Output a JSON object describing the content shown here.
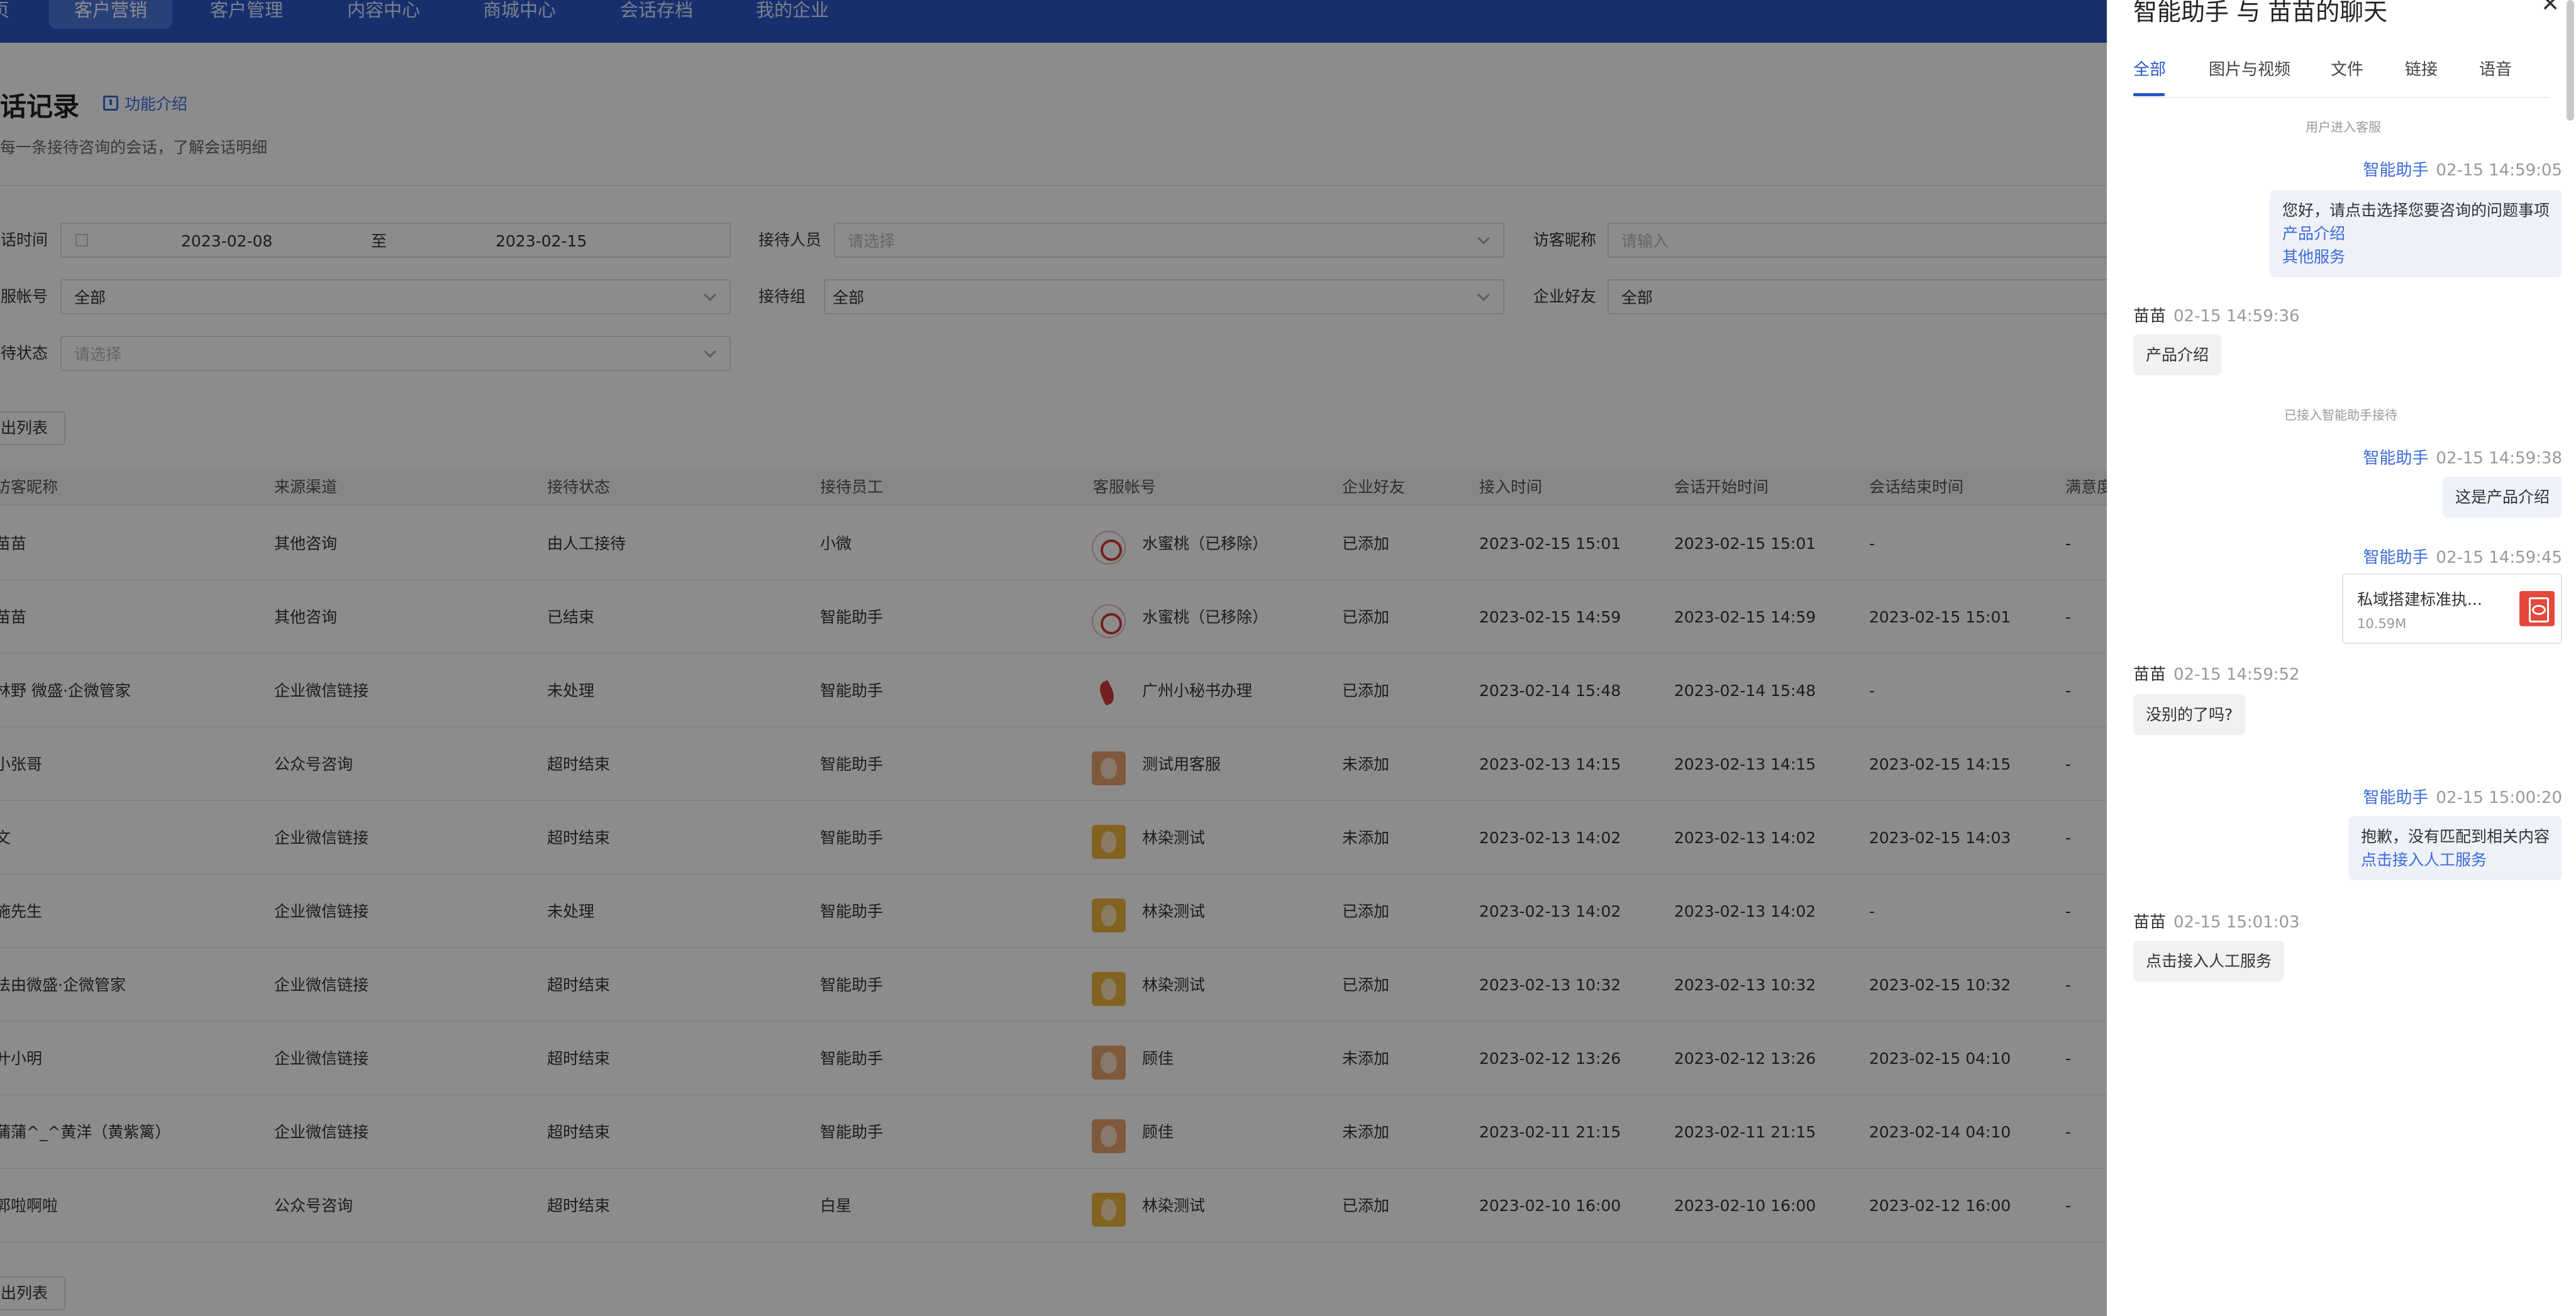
{
  "nav": {
    "items": [
      {
        "label": "页"
      },
      {
        "label": "客户营销"
      },
      {
        "label": "客户管理"
      },
      {
        "label": "内容中心"
      },
      {
        "label": "商城中心"
      },
      {
        "label": "会话存档"
      },
      {
        "label": "我的企业"
      }
    ],
    "active_index": 1
  },
  "page": {
    "title": "会话记录",
    "feature_link": "功能介绍",
    "subtitle": "查看每一条接待咨询的会话，了解会话明细"
  },
  "filters": {
    "session_time_label": "会话时间",
    "date_start": "2023-02-08",
    "date_sep": "至",
    "date_end": "2023-02-15",
    "staff_label": "接待人员",
    "staff_placeholder": "请选择",
    "visitor_nickname_label": "访客昵称",
    "visitor_nickname_placeholder": "请输入",
    "service_account_label": "客服帐号",
    "service_account_value": "全部",
    "group_label": "接待组",
    "group_value": "全部",
    "wecom_friend_label": "企业好友",
    "wecom_friend_value": "全部",
    "status_label": "接待状态",
    "status_placeholder": "请选择"
  },
  "export_label": "导出列表",
  "table": {
    "headers": [
      "访客昵称",
      "来源渠道",
      "接待状态",
      "接待员工",
      "客服帐号",
      "企业好友",
      "接入时间",
      "会话开始时间",
      "会话结束时间",
      "满意度"
    ],
    "rows": [
      {
        "nickname": "苗苗",
        "channel": "其他咨询",
        "status": "由人工接待",
        "staff": "小微",
        "avatar": "logo-icon",
        "account": "水蜜桃（已移除）",
        "friend": "已添加",
        "join": "2023-02-15 15:01",
        "start": "2023-02-15 15:01",
        "end": "-",
        "sat": "-"
      },
      {
        "nickname": "苗苗",
        "channel": "其他咨询",
        "status": "已结束",
        "staff": "智能助手",
        "avatar": "logo-icon",
        "account": "水蜜桃（已移除）",
        "friend": "已添加",
        "join": "2023-02-15 14:59",
        "start": "2023-02-15 14:59",
        "end": "2023-02-15 15:01",
        "sat": "-"
      },
      {
        "nickname": "林野 微盛·企微管家",
        "channel": "企业微信链接",
        "status": "未处理",
        "staff": "智能助手",
        "avatar": "bird-icon",
        "account": "广州小秘书办理",
        "friend": "已添加",
        "join": "2023-02-14 15:48",
        "start": "2023-02-14 15:48",
        "end": "-",
        "sat": "-"
      },
      {
        "nickname": "小张哥",
        "channel": "公众号咨询",
        "status": "超时结束",
        "staff": "智能助手",
        "avatar": "girl-avatar-icon",
        "account": "测试用客服",
        "friend": "未添加",
        "join": "2023-02-13 14:15",
        "start": "2023-02-13 14:15",
        "end": "2023-02-15 14:15",
        "sat": "-"
      },
      {
        "nickname": "文",
        "channel": "企业微信链接",
        "status": "超时结束",
        "staff": "智能助手",
        "avatar": "yellow-avatar-icon",
        "account": "林染测试",
        "friend": "未添加",
        "join": "2023-02-13 14:02",
        "start": "2023-02-13 14:02",
        "end": "2023-02-15 14:03",
        "sat": "-"
      },
      {
        "nickname": "施先生",
        "channel": "企业微信链接",
        "status": "未处理",
        "staff": "智能助手",
        "avatar": "yellow-avatar-icon",
        "account": "林染测试",
        "friend": "已添加",
        "join": "2023-02-13 14:02",
        "start": "2023-02-13 14:02",
        "end": "-",
        "sat": "-"
      },
      {
        "nickname": "法由微盛·企微管家",
        "channel": "企业微信链接",
        "status": "超时结束",
        "staff": "智能助手",
        "avatar": "yellow-avatar-icon",
        "account": "林染测试",
        "friend": "已添加",
        "join": "2023-02-13 10:32",
        "start": "2023-02-13 10:32",
        "end": "2023-02-15 10:32",
        "sat": "-"
      },
      {
        "nickname": "叶小明",
        "channel": "企业微信链接",
        "status": "超时结束",
        "staff": "智能助手",
        "avatar": "girl-avatar-icon",
        "account": "顾佳",
        "friend": "未添加",
        "join": "2023-02-12 13:26",
        "start": "2023-02-12 13:26",
        "end": "2023-02-15 04:10",
        "sat": "-"
      },
      {
        "nickname": "蒲蒲^_^黄洋（黄紫篱）",
        "channel": "企业微信链接",
        "status": "超时结束",
        "staff": "智能助手",
        "avatar": "girl-avatar-icon",
        "account": "顾佳",
        "friend": "未添加",
        "join": "2023-02-11 21:15",
        "start": "2023-02-11 21:15",
        "end": "2023-02-14 04:10",
        "sat": "-"
      },
      {
        "nickname": "郭啦啊啦",
        "channel": "公众号咨询",
        "status": "超时结束",
        "staff": "白星",
        "avatar": "yellow-avatar-icon",
        "account": "林染测试",
        "friend": "已添加",
        "join": "2023-02-10 16:00",
        "start": "2023-02-10 16:00",
        "end": "2023-02-12 16:00",
        "sat": "-"
      }
    ]
  },
  "drawer": {
    "title": "智能助手 与 苗苗的聊天",
    "close": "✕",
    "tabs": [
      "全部",
      "图片与视频",
      "文件",
      "链接",
      "语音"
    ],
    "messages": {
      "sys1": "用户进入客服",
      "m1_name": "智能助手",
      "m1_time": "02-15 14:59:05",
      "m1_text": "您好，请点击选择您要咨询的问题事项",
      "m1_link1": "产品介绍",
      "m1_link2": "其他服务",
      "m2_name": "苗苗",
      "m2_time": "02-15 14:59:36",
      "m2_text": "产品介绍",
      "sys2": "已接入智能助手接待",
      "m3_name": "智能助手",
      "m3_time": "02-15 14:59:38",
      "m3_text": "这是产品介绍",
      "m4_name": "智能助手",
      "m4_time": "02-15 14:59:45",
      "m4_file_name": "私域搭建标准执...",
      "m4_file_size": "10.59M",
      "m5_name": "苗苗",
      "m5_time": "02-15 14:59:52",
      "m5_text": "没别的了吗?",
      "m6_name": "智能助手",
      "m6_time": "02-15 15:00:20",
      "m6_text": "抱歉，没有匹配到相关内容",
      "m6_link": "点击接入人工服务",
      "m7_name": "苗苗",
      "m7_time": "02-15 15:01:03",
      "m7_text": "点击接入人工服务"
    }
  },
  "colors": {
    "nav_bg": "#2a57c6",
    "accent": "#3a6bdc",
    "pdf": "#e5483c"
  }
}
